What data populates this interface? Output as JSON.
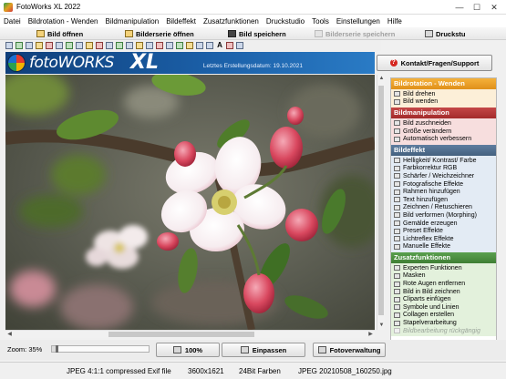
{
  "window": {
    "title": "FotoWorks XL 2022",
    "controls": {
      "minimize": "—",
      "maximize": "☐",
      "close": "✕"
    }
  },
  "menu": [
    "Datei",
    "Bildrotation - Wenden",
    "Bildmanipulation",
    "Bildeffekt",
    "Zusatzfunktionen",
    "Druckstudio",
    "Tools",
    "Einstellungen",
    "Hilfe"
  ],
  "toolbar": {
    "open_image": "Bild öffnen",
    "open_series": "Bilderserie öffnen",
    "save_image": "Bild speichern",
    "save_series": "Bilderserie speichern",
    "print": "Druckstu"
  },
  "banner": {
    "logo_text": "fotoWORKS",
    "logo_xl": "XL",
    "date_label": "Letztes Erstellungsdatum: 19.10.2021"
  },
  "contact_button": "Kontakt/Fragen/Support",
  "panel": {
    "sections": [
      {
        "title": "Bildrotation - Wenden",
        "items": [
          "Bild drehen",
          "Bild wenden"
        ]
      },
      {
        "title": "Bildmanipulation",
        "items": [
          "Bild zuschneiden",
          "Größe verändern",
          "Automatisch verbessern"
        ]
      },
      {
        "title": "Bildeffekt",
        "items": [
          "Helligkeit/ Kontrast/ Farbe",
          "Farbkorrektur RGB",
          "Schärfer / Weichzeichner",
          "Fotografische Effekte",
          "Rahmen hinzufügen",
          "Text hinzufügen",
          "Zeichnen / Retuschieren",
          "Bild verformen (Morphing)",
          "Gemälde erzeugen",
          "Preset Effekte",
          "Lichtreflex Effekte",
          "Manuelle Effekte"
        ]
      },
      {
        "title": "Zusatzfunktionen",
        "items": [
          "Experten Funktionen",
          "Masken",
          "Rote Augen entfernen",
          "Bild in Bild zeichnen",
          "Cliparts einfügen",
          "Symbole und Linien",
          "Collagen erstellen",
          "Stapelverarbeitung",
          "Bildbearbeitung rückgängig"
        ]
      }
    ]
  },
  "bottom": {
    "zoom_label": "Zoom: 35%",
    "zoom_percent": 35,
    "btn_100": "100%",
    "btn_fit": "Einpassen",
    "btn_manager": "Fotoverwaltung"
  },
  "status": {
    "format": "JPEG 4:1:1 compressed Exif file",
    "dimensions": "3600x1621",
    "colors": "24Bit Farben",
    "filename": "JPEG 20210508_160250.jpg"
  }
}
